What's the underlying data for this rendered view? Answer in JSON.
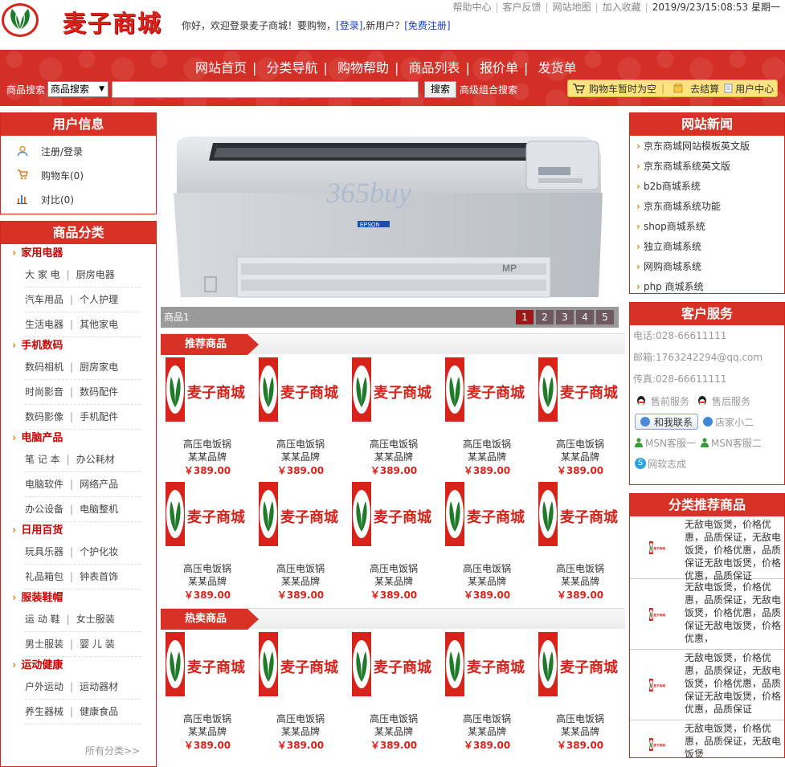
{
  "header": {
    "logo_text": "麦子商城",
    "welcome": "你好，欢迎登录麦子商城！要购物，",
    "login": "[登录]",
    "new_user": ",新用户？",
    "register": "[免费注册]",
    "top_links": [
      "帮助中心",
      "客户反馈",
      "网站地图",
      "加入收藏"
    ],
    "datetime": "2019/9/23/15:08:53 星期一"
  },
  "nav": {
    "items": [
      "网站首页",
      "分类导航",
      "购物帮助",
      "商品列表",
      "报价单",
      "发货单"
    ],
    "search_label": "商品搜索",
    "search_select": "商品搜索",
    "search_button": "搜索",
    "advanced": "高级组合搜索",
    "cart_empty": "购物车暂时为空",
    "checkout": "去结算",
    "user_center": "用户中心"
  },
  "user_info": {
    "title": "用户信息",
    "items": [
      {
        "icon": "user-icon",
        "label": "注册/登录"
      },
      {
        "icon": "cart-icon",
        "label": "购物车(0)"
      },
      {
        "icon": "bar-chart-icon",
        "label": "对比(0)"
      }
    ]
  },
  "categories": {
    "title": "商品分类",
    "groups": [
      {
        "name": "家用电器",
        "rows": [
          [
            "大 家 电",
            "厨房电器"
          ],
          [
            "汽车用品",
            "个人护理"
          ],
          [
            "生活电器",
            "其他家电"
          ]
        ]
      },
      {
        "name": "手机数码",
        "rows": [
          [
            "数码相机",
            "厨房家电"
          ],
          [
            "时尚影音",
            "数码配件"
          ],
          [
            "数码影像",
            "手机配件"
          ]
        ]
      },
      {
        "name": "电脑产品",
        "rows": [
          [
            "笔 记 本",
            "办公耗材"
          ],
          [
            "电脑软件",
            "网络产品"
          ],
          [
            "办公设备",
            "电脑整机"
          ]
        ]
      },
      {
        "name": "日用百货",
        "rows": [
          [
            "玩具乐器",
            "个护化妆"
          ],
          [
            "礼品箱包",
            "钟表首饰"
          ]
        ]
      },
      {
        "name": "服装鞋帽",
        "rows": [
          [
            "运 动 鞋",
            "女士服装"
          ],
          [
            "男士服装",
            "婴 儿 装"
          ]
        ]
      },
      {
        "name": "运动健康",
        "rows": [
          [
            "户外运动",
            "运动器材"
          ],
          [
            "养生器械",
            "健康食品"
          ]
        ]
      }
    ],
    "all": "所有分类>>"
  },
  "banner": {
    "caption": "商品1",
    "pages": [
      "1",
      "2",
      "3",
      "4",
      "5"
    ],
    "brand_small": "EPSON",
    "watermark": "365buy",
    "badge": "MP"
  },
  "sections": [
    {
      "title": "推荐商品"
    },
    {
      "title": "热卖商品"
    }
  ],
  "product": {
    "name": "高压电饭锅",
    "brand": "某某品牌",
    "price": "￥389.00",
    "logo_text": "麦子商城"
  },
  "news": {
    "title": "网站新闻",
    "items": [
      "京东商城网站模板英文版",
      "京东商城系统英文版",
      "b2b商城系统",
      "京东商城系统功能",
      "shop商城系统",
      "独立商城系统",
      "网购商城系统",
      "php 商城系统"
    ]
  },
  "service": {
    "title": "客户服务",
    "phone": "电话:028-66611111",
    "email": "邮箱:1763242294@qq.com",
    "fax": "传真:028-66611111",
    "presale": "售前服务",
    "aftersale": "售后服务",
    "contact": "和我联系",
    "shop2": "店家小二",
    "msn1": "MSN客服一",
    "msn2": "MSN客服二",
    "skype": "网软志成"
  },
  "reco": {
    "title": "分类推荐商品",
    "items": [
      "无敌电饭煲，价格优惠，品质保证，无敌电饭煲，价格优惠，品质保证无敌电饭煲，价格优惠，品质保证",
      "无敌电饭煲，价格优惠，品质保证，无敌电饭煲，价格优惠，品质保证无敌电饭煲，价格优惠，",
      "无敌电饭煲，价格优惠，品质保证，无敌电饭煲，价格优惠，品质保证无敌电饭煲，价格优惠，品质保证",
      "无敌电饭煲，价格优惠，品质保证，无敌电饭煲"
    ]
  },
  "colors": {
    "brand_red": "#d8231b",
    "nav_red": "#d42f26",
    "link_blue": "#1a3fbd",
    "cart_yellow": "#fbe37e"
  }
}
